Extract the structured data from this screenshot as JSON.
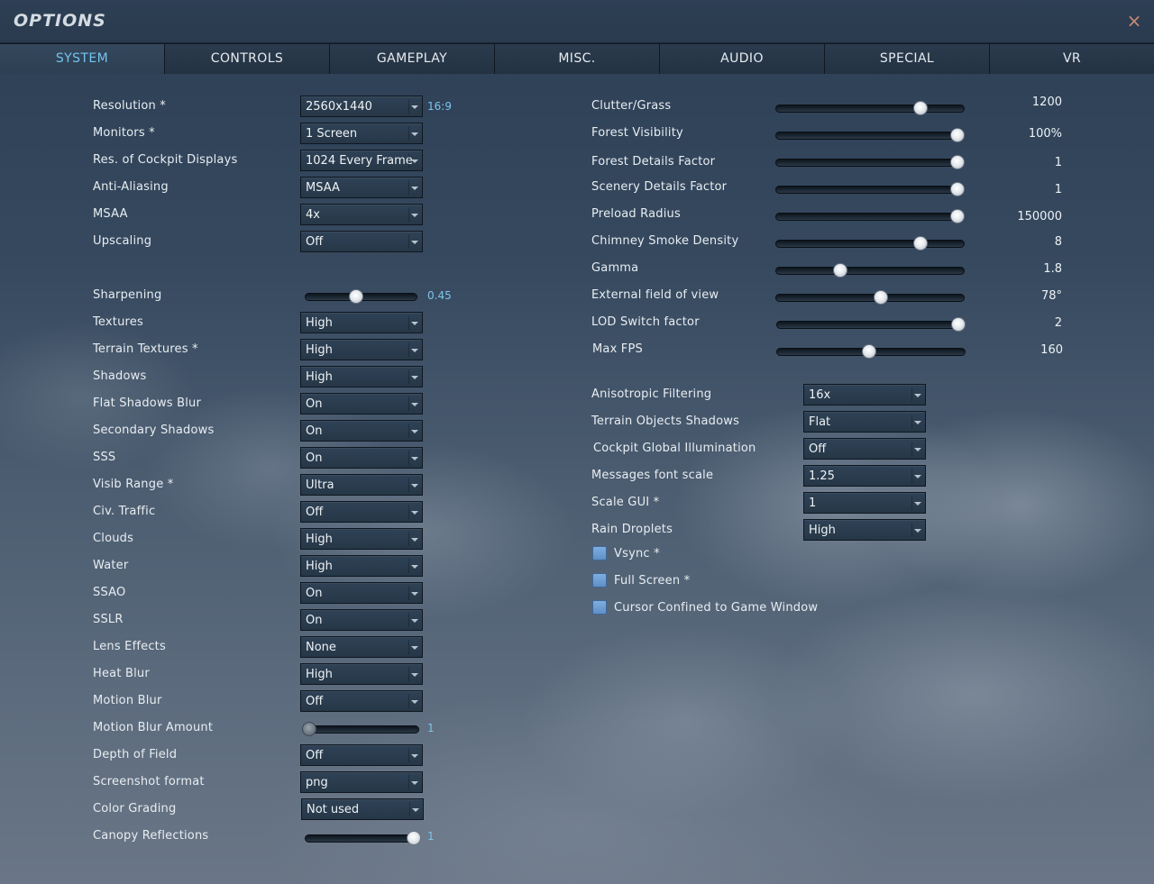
{
  "window": {
    "title": "OPTIONS",
    "close_icon": "×"
  },
  "tabs": [
    "SYSTEM",
    "CONTROLS",
    "GAMEPLAY",
    "MISC.",
    "AUDIO",
    "SPECIAL",
    "VR"
  ],
  "active_tab": "SYSTEM",
  "left": {
    "resolution": {
      "label": "Resolution *",
      "value": "2560x1440",
      "aspect": "16:9"
    },
    "monitors": {
      "label": "Monitors *",
      "value": "1 Screen"
    },
    "cockpit_displays": {
      "label": "Res. of Cockpit Displays",
      "value": "1024 Every Frame"
    },
    "anti_aliasing": {
      "label": "Anti-Aliasing",
      "value": "MSAA"
    },
    "msaa": {
      "label": "MSAA",
      "value": "4x"
    },
    "upscaling": {
      "label": "Upscaling",
      "value": "Off"
    },
    "sharpening": {
      "label": "Sharpening",
      "value": "0.45",
      "level": 0.45
    },
    "textures": {
      "label": "Textures",
      "value": "High"
    },
    "terrain_textures": {
      "label": "Terrain Textures *",
      "value": "High"
    },
    "shadows": {
      "label": "Shadows",
      "value": "High"
    },
    "flat_shadows_blur": {
      "label": "Flat Shadows Blur",
      "value": "On"
    },
    "secondary_shadows": {
      "label": "Secondary Shadows",
      "value": "On"
    },
    "sss": {
      "label": "SSS",
      "value": "On"
    },
    "visib_range": {
      "label": "Visib Range *",
      "value": "Ultra"
    },
    "civ_traffic": {
      "label": "Civ. Traffic",
      "value": "Off"
    },
    "clouds": {
      "label": "Clouds",
      "value": "High"
    },
    "water": {
      "label": "Water",
      "value": "High"
    },
    "ssao": {
      "label": "SSAO",
      "value": "On"
    },
    "sslr": {
      "label": "SSLR",
      "value": "On"
    },
    "lens_effects": {
      "label": "Lens Effects",
      "value": "None"
    },
    "heat_blur": {
      "label": "Heat Blur",
      "value": "High"
    },
    "motion_blur": {
      "label": "Motion Blur",
      "value": "Off"
    },
    "motion_blur_amount": {
      "label": "Motion Blur Amount",
      "value": "1",
      "level": 0.0
    },
    "depth_of_field": {
      "label": "Depth of Field",
      "value": "Off"
    },
    "screenshot_format": {
      "label": "Screenshot format",
      "value": "png"
    },
    "color_grading": {
      "label": "Color Grading",
      "value": "Not used"
    },
    "canopy_reflections": {
      "label": "Canopy Reflections",
      "value": "1",
      "level": 1.0
    }
  },
  "right_sliders": [
    {
      "label": "Clutter/Grass",
      "value": "1200",
      "level": 0.79
    },
    {
      "label": "Forest Visibility",
      "value": "100%",
      "level": 1.0
    },
    {
      "label": "Forest Details Factor",
      "value": "1",
      "level": 1.0
    },
    {
      "label": "Scenery Details Factor",
      "value": "1",
      "level": 1.0
    },
    {
      "label": "Preload Radius",
      "value": "150000",
      "level": 1.0
    },
    {
      "label": "Chimney Smoke Density",
      "value": "8",
      "level": 0.79
    },
    {
      "label": "Gamma",
      "value": "1.8",
      "level": 0.33
    },
    {
      "label": "External field of view",
      "value": "78°",
      "level": 0.56
    },
    {
      "label": "LOD Switch factor",
      "value": "2",
      "level": 1.0
    },
    {
      "label": "Max FPS",
      "value": "160",
      "level": 0.49
    }
  ],
  "right_dropdowns": [
    {
      "label": "Anisotropic Filtering",
      "value": "16x"
    },
    {
      "label": "Terrain Objects Shadows",
      "value": "Flat"
    },
    {
      "label": "Cockpit Global Illumination",
      "value": "Off"
    },
    {
      "label": "Messages font scale",
      "value": "1.25"
    },
    {
      "label": "Scale GUI *",
      "value": "1"
    },
    {
      "label": "Rain Droplets",
      "value": "High"
    }
  ],
  "checkboxes": [
    {
      "label": "Vsync *",
      "checked": false
    },
    {
      "label": "Full Screen *",
      "checked": false
    },
    {
      "label": "Cursor Confined to Game Window",
      "checked": false
    }
  ]
}
